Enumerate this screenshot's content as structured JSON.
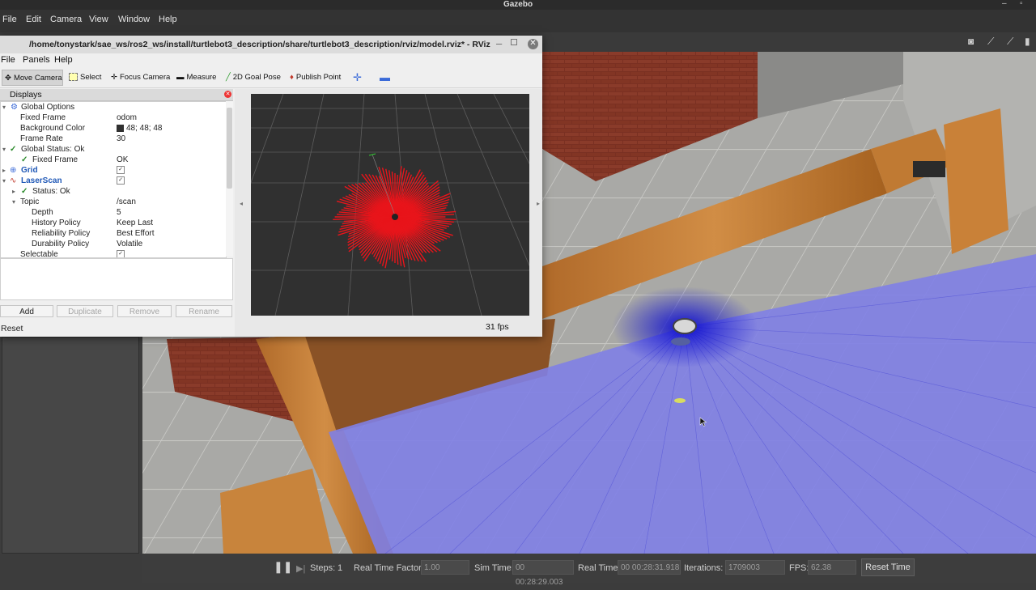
{
  "gazebo": {
    "title": "Gazebo",
    "menu": [
      "File",
      "Edit",
      "Camera",
      "View",
      "Window",
      "Help"
    ],
    "bottom": {
      "steps_label": "Steps:",
      "steps_value": "1",
      "rtf_label": "Real Time Factor:",
      "rtf_value": "1.00",
      "sim_time_label": "Sim Time:",
      "sim_time_value": "00 00:28:29.003",
      "real_time_label": "Real Time:",
      "real_time_value": "00 00:28:31.918",
      "iterations_label": "Iterations:",
      "iterations_value": "1709003",
      "fps_label": "FPS:",
      "fps_value": "62.38",
      "reset_time_label": "Reset Time"
    }
  },
  "rviz": {
    "title": "/home/tonystark/sae_ws/ros2_ws/install/turtlebot3_description/share/turtlebot3_description/rviz/model.rviz* - RViz",
    "menu": [
      "File",
      "Panels",
      "Help"
    ],
    "tools": [
      {
        "label": "Move Camera",
        "icon": "move-camera-icon"
      },
      {
        "label": "Select",
        "icon": "select-icon"
      },
      {
        "label": "Focus Camera",
        "icon": "focus-camera-icon"
      },
      {
        "label": "Measure",
        "icon": "measure-icon"
      },
      {
        "label": "2D Goal Pose",
        "icon": "goal-pose-icon"
      },
      {
        "label": "Publish Point",
        "icon": "publish-point-icon"
      }
    ],
    "displays": {
      "title": "Displays",
      "rows": [
        {
          "key": "Global Options",
          "value": ""
        },
        {
          "key": "Fixed Frame",
          "value": "odom"
        },
        {
          "key": "Background Color",
          "value": "48; 48; 48"
        },
        {
          "key": "Frame Rate",
          "value": "30"
        },
        {
          "key": "Global Status: Ok",
          "value": ""
        },
        {
          "key": "Fixed Frame",
          "value": "OK"
        },
        {
          "key": "Grid",
          "value": "✓"
        },
        {
          "key": "LaserScan",
          "value": "✓"
        },
        {
          "key": "Status: Ok",
          "value": ""
        },
        {
          "key": "Topic",
          "value": "/scan"
        },
        {
          "key": "Depth",
          "value": "5"
        },
        {
          "key": "History Policy",
          "value": "Keep Last"
        },
        {
          "key": "Reliability Policy",
          "value": "Best Effort"
        },
        {
          "key": "Durability Policy",
          "value": "Volatile"
        },
        {
          "key": "Selectable",
          "value": "✓"
        }
      ],
      "buttons": {
        "add": "Add",
        "duplicate": "Duplicate",
        "remove": "Remove",
        "rename": "Rename"
      },
      "reset": "Reset"
    },
    "fps": "31 fps",
    "colors": {
      "view_bg": "#303030",
      "scan": "#e8141a",
      "gazebo_scan": "#3a3ad8"
    }
  }
}
